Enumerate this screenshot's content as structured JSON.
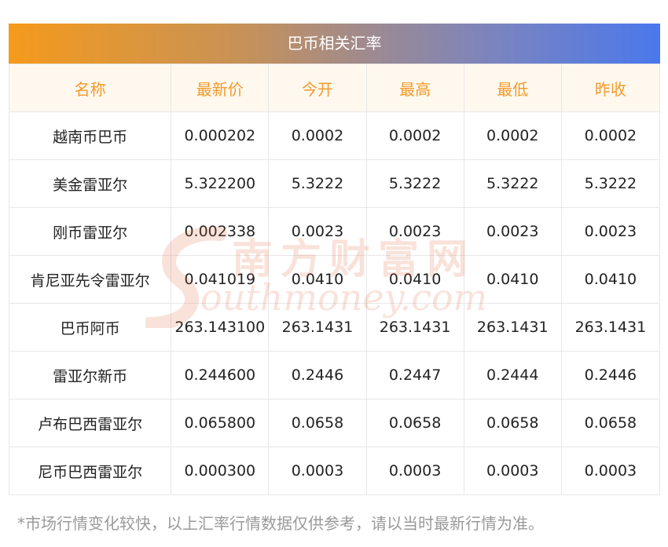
{
  "title": "巴币相关汇率",
  "headers": [
    "名称",
    "最新价",
    "今开",
    "最高",
    "最低",
    "昨收"
  ],
  "rows": [
    [
      "越南币巴币",
      "0.000202",
      "0.0002",
      "0.0002",
      "0.0002",
      "0.0002"
    ],
    [
      "美金雷亚尔",
      "5.322200",
      "5.3222",
      "5.3222",
      "5.3222",
      "5.3222"
    ],
    [
      "刚币雷亚尔",
      "0.002338",
      "0.0023",
      "0.0023",
      "0.0023",
      "0.0023"
    ],
    [
      "肯尼亚先令雷亚尔",
      "0.041019",
      "0.0410",
      "0.0410",
      "0.0410",
      "0.0410"
    ],
    [
      "巴币阿币",
      "263.143100",
      "263.1431",
      "263.1431",
      "263.1431",
      "263.1431"
    ],
    [
      "雷亚尔新币",
      "0.244600",
      "0.2446",
      "0.2447",
      "0.2444",
      "0.2446"
    ],
    [
      "卢布巴西雷亚尔",
      "0.065800",
      "0.0658",
      "0.0658",
      "0.0658",
      "0.0658"
    ],
    [
      "尼币巴西雷亚尔",
      "0.000300",
      "0.0003",
      "0.0003",
      "0.0003",
      "0.0003"
    ]
  ],
  "watermark": {
    "cn": "南方财富网",
    "en": "outhmoney.com"
  },
  "footnote": "*市场行情变化较快，以上汇率行情数据仅供参考，请以当时最新行情为准。",
  "colors": {
    "header_text": "#f39a2a",
    "header_bg": "#fff8ef",
    "title_gradient_start": "#f59a1c",
    "title_gradient_end": "#4a78ec"
  }
}
